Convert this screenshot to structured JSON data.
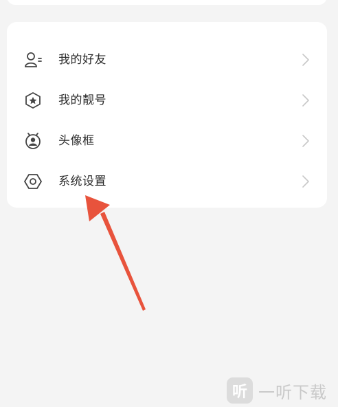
{
  "menu": {
    "items": [
      {
        "label": "我的好友",
        "icon": "friends-icon"
      },
      {
        "label": "我的靓号",
        "icon": "vip-number-icon"
      },
      {
        "label": "头像框",
        "icon": "avatar-frame-icon"
      },
      {
        "label": "系统设置",
        "icon": "settings-icon"
      }
    ]
  },
  "watermark": {
    "logo_char": "听",
    "text": "一听下载"
  },
  "colors": {
    "background": "#f4f4f4",
    "card": "#ffffff",
    "text": "#2a2a2a",
    "icon": "#444444",
    "chevron": "#c8c8c8",
    "arrow": "#e8533c"
  }
}
